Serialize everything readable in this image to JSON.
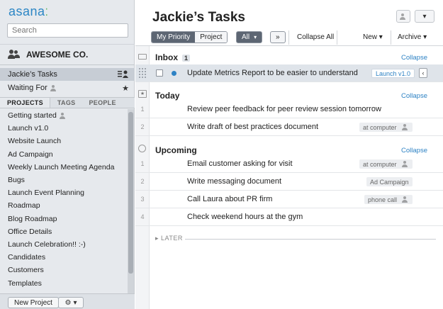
{
  "sidebar": {
    "logo": "asana",
    "logo_dots": "⁚",
    "search_placeholder": "Search",
    "org_name": "AWESOME CO.",
    "nav": [
      {
        "label": "Jackie’s Tasks"
      },
      {
        "label": "Waiting For"
      }
    ],
    "tabs": [
      "PROJECTS",
      "TAGS",
      "PEOPLE"
    ],
    "projects": [
      "Getting started",
      "Launch v1.0",
      "Website Launch",
      "Ad Campaign",
      "Weekly Launch Meeting Agenda",
      "Bugs",
      "Launch Event Planning",
      "Roadmap",
      "Blog Roadmap",
      "Office Details",
      "Launch Celebration!! :-)",
      "Candidates",
      "Customers",
      "Templates"
    ],
    "new_project_label": "New Project",
    "gear_label": "⚙",
    "gear_caret": "▾"
  },
  "main": {
    "title": "Jackie’s Tasks",
    "toolbar": {
      "my_priority": "My Priority",
      "project": "Project",
      "all": "All",
      "all_caret": "▾",
      "expand": "»",
      "collapse_all": "Collapse All",
      "new": "New",
      "archive": "Archive",
      "caret": "▾"
    },
    "sections": {
      "inbox": {
        "label": "Inbox",
        "count": "1",
        "collapse": "Collapse"
      },
      "today": {
        "label": "Today",
        "collapse": "Collapse"
      },
      "upcoming": {
        "label": "Upcoming",
        "collapse": "Collapse"
      }
    },
    "tasks": {
      "inbox": [
        {
          "name": "Update Metrics Report to be easier to understand",
          "tag": "Launch v1.0",
          "chev": "‹"
        }
      ],
      "today": [
        {
          "num": "1",
          "name": "Review peer feedback for peer review session tomorrow"
        },
        {
          "num": "2",
          "name": "Write draft of best practices document",
          "tag": "at computer"
        }
      ],
      "upcoming": [
        {
          "num": "1",
          "name": "Email customer asking for visit",
          "tag": "at computer"
        },
        {
          "num": "2",
          "name": "Write messaging document",
          "tag": "Ad Campaign"
        },
        {
          "num": "3",
          "name": "Call Laura about PR firm",
          "tag": "phone call"
        },
        {
          "num": "4",
          "name": "Check weekend hours at the gym"
        }
      ]
    },
    "later_label": "LATER",
    "later_arrow": "▸",
    "header_caret": "▾",
    "star": "★",
    "cal_glyph": "★"
  }
}
